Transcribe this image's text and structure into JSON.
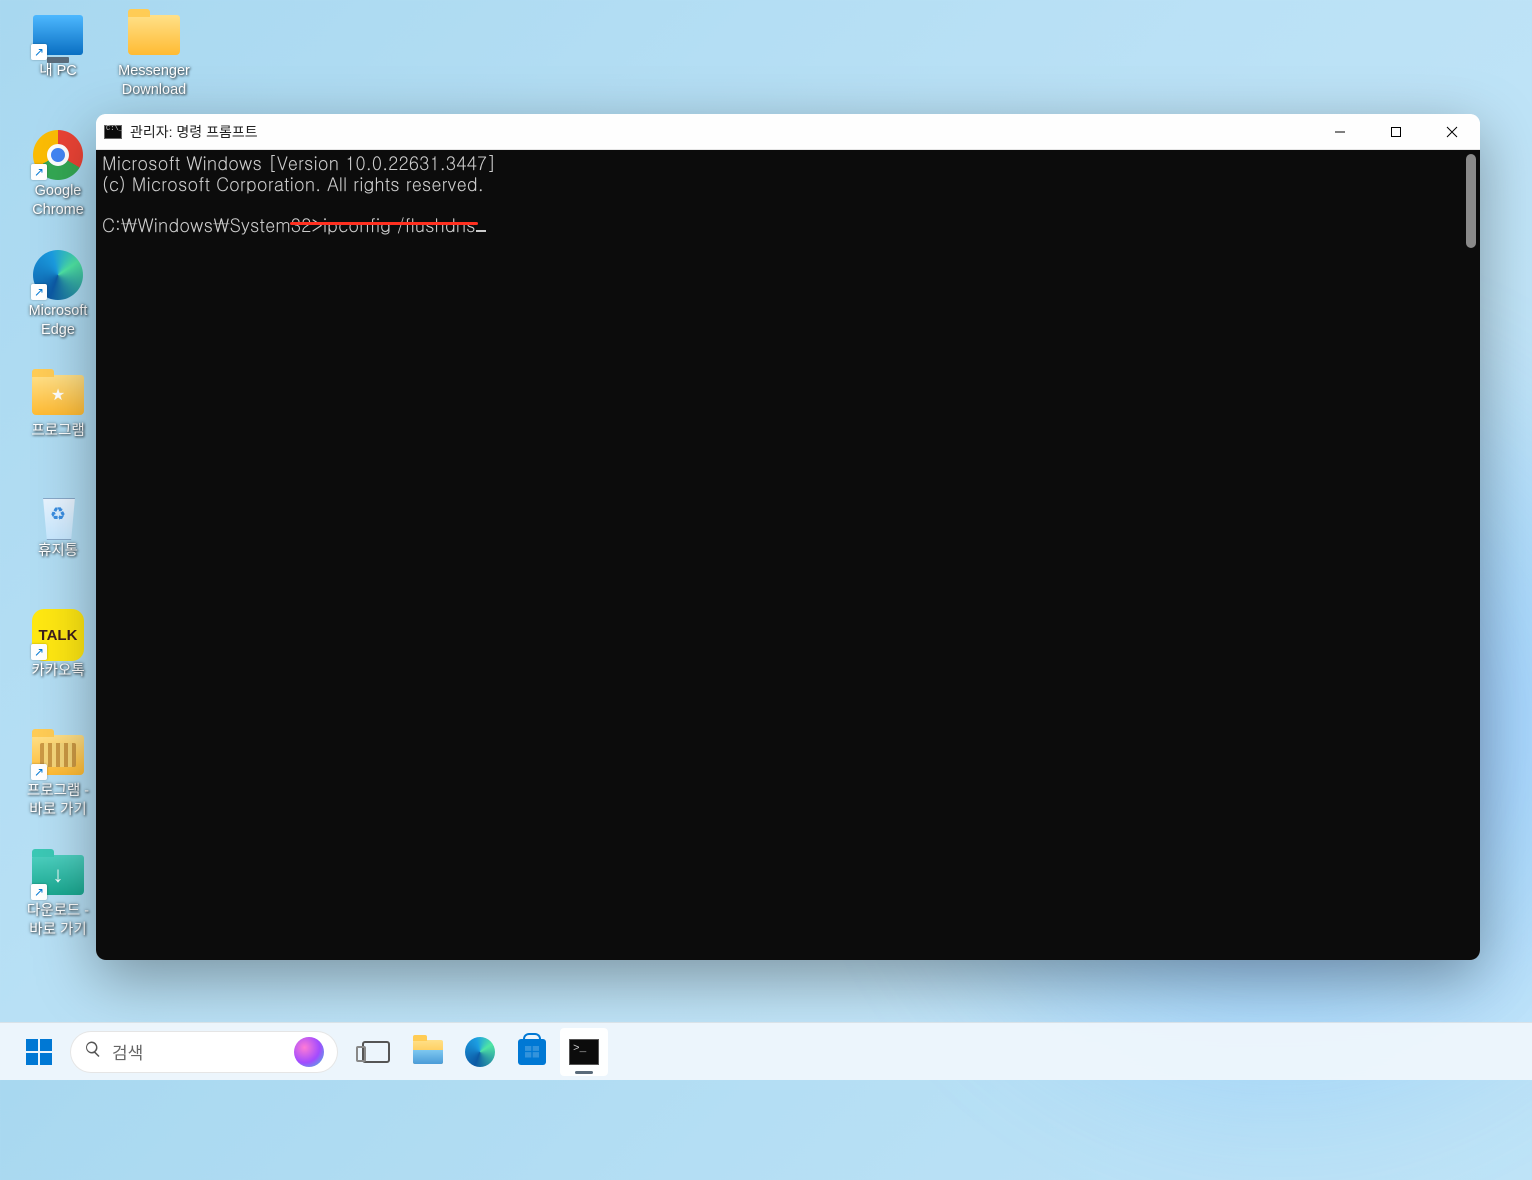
{
  "desktop": {
    "icons_col1": [
      {
        "label": "내 PC",
        "type": "mypc",
        "shortcut": true
      },
      {
        "label": "Google\nChrome",
        "type": "chrome",
        "shortcut": true
      },
      {
        "label": "Microsoft\nEdge",
        "type": "edge",
        "shortcut": true
      },
      {
        "label": "프로그램",
        "type": "folder-star",
        "shortcut": false
      },
      {
        "label": "휴지통",
        "type": "recycle",
        "shortcut": false
      },
      {
        "label": "카카오톡",
        "type": "kakao",
        "shortcut": true
      },
      {
        "label": "프로그램 -\n바로 가기",
        "type": "folder-files",
        "shortcut": true
      },
      {
        "label": "다운로드 -\n바로 가기",
        "type": "folder-dl",
        "shortcut": true
      }
    ],
    "icons_col2": [
      {
        "label": "Messenger\nDownload",
        "type": "folder",
        "shortcut": false
      }
    ]
  },
  "cmd_window": {
    "title": "관리자: 명령 프롬프트",
    "lines": {
      "l1": "Microsoft Windows [Version 10.0.22631.3447]",
      "l2": "(c) Microsoft Corporation. All rights reserved.",
      "l3_prompt": "C:\\Windows\\System32>",
      "l3_cmd": "ipconfig /flushdns"
    }
  },
  "taskbar": {
    "search_placeholder": "검색",
    "items": [
      {
        "name": "task-view",
        "active": false
      },
      {
        "name": "file-explorer",
        "active": false
      },
      {
        "name": "microsoft-edge",
        "active": false
      },
      {
        "name": "microsoft-store",
        "active": false
      },
      {
        "name": "command-prompt",
        "active": true
      }
    ]
  },
  "kakao_text": "TALK"
}
